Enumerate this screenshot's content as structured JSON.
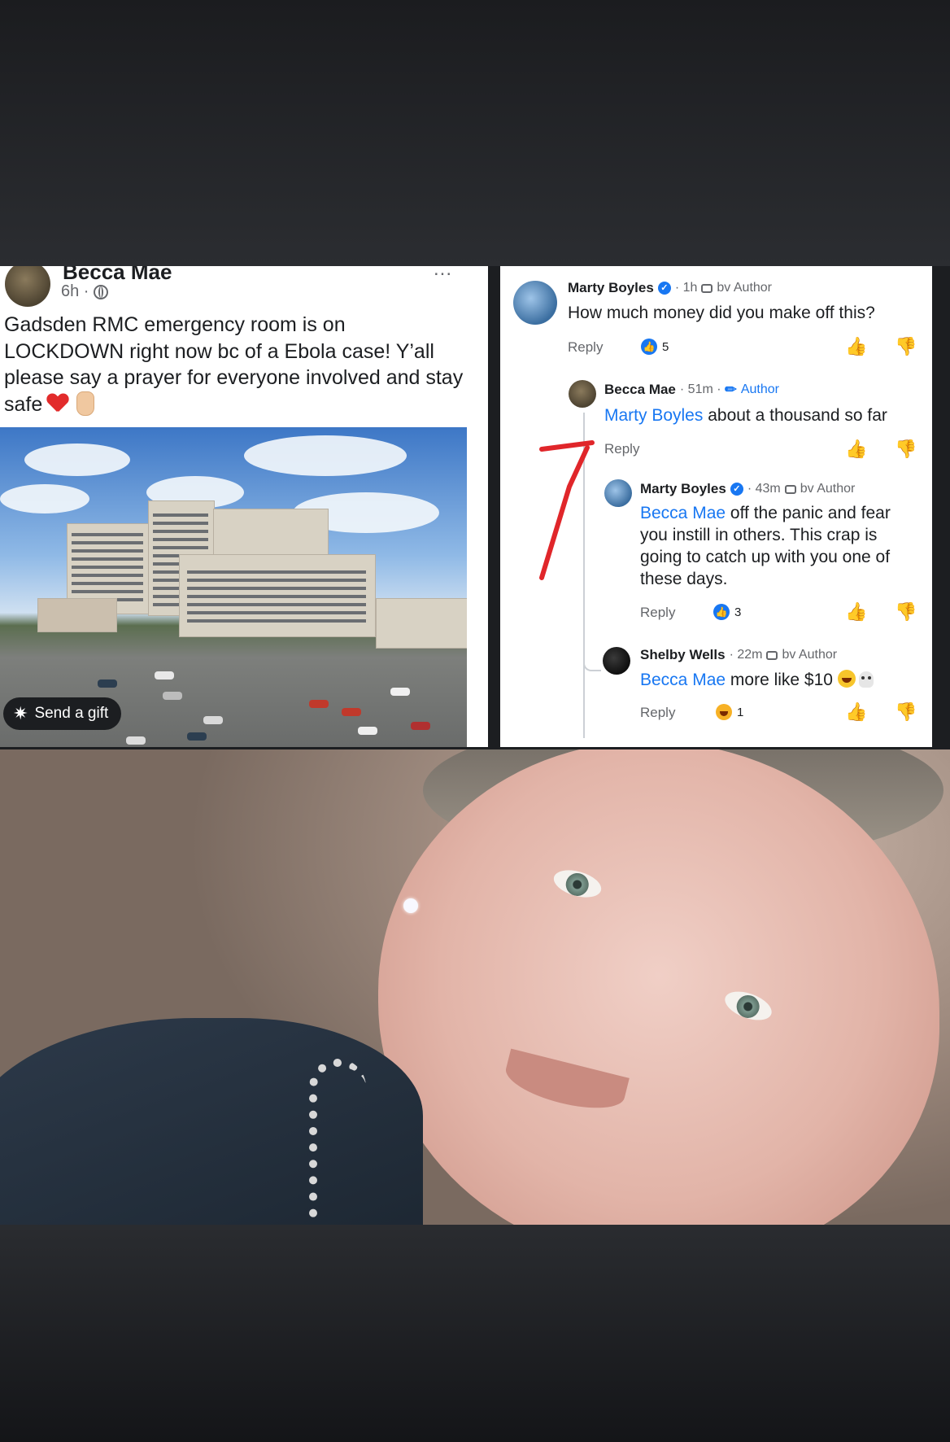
{
  "post": {
    "author": "Becca Mae",
    "time": "6h ·",
    "menu": "...",
    "text": "Gadsden RMC emergency room is on LOCKDOWN right now bc of a Ebola case! Y’all please say a prayer for everyone involved and stay safe",
    "send_gift_label": "Send a gift"
  },
  "comments": [
    {
      "author": "Marty Boyles",
      "time": "· 1h",
      "tag": "bv Author",
      "text": "How much money did you make off this?",
      "reply_label": "Reply",
      "reaction_count": "5"
    },
    {
      "author": "Becca Mae",
      "time": "· 51m ·",
      "tag": "Author",
      "mention": "Marty Boyles",
      "text": " about a thousand so far",
      "reply_label": "Reply"
    },
    {
      "author": "Marty Boyles",
      "time": "· 43m",
      "tag": "bv Author",
      "mention": "Becca Mae",
      "text": " off the panic and fear you instill in others. This crap is going to catch up with you one of these days.",
      "reply_label": "Reply",
      "reaction_count": "3"
    },
    {
      "author": "Shelby Wells",
      "time": "· 22m",
      "tag": "bv Author",
      "mention": "Becca Mae",
      "text": " more like $10",
      "reply_label": "Reply",
      "reaction_count": "1"
    }
  ],
  "colors": {
    "link_blue": "#1877f2",
    "arrow_red": "#e0262a"
  }
}
